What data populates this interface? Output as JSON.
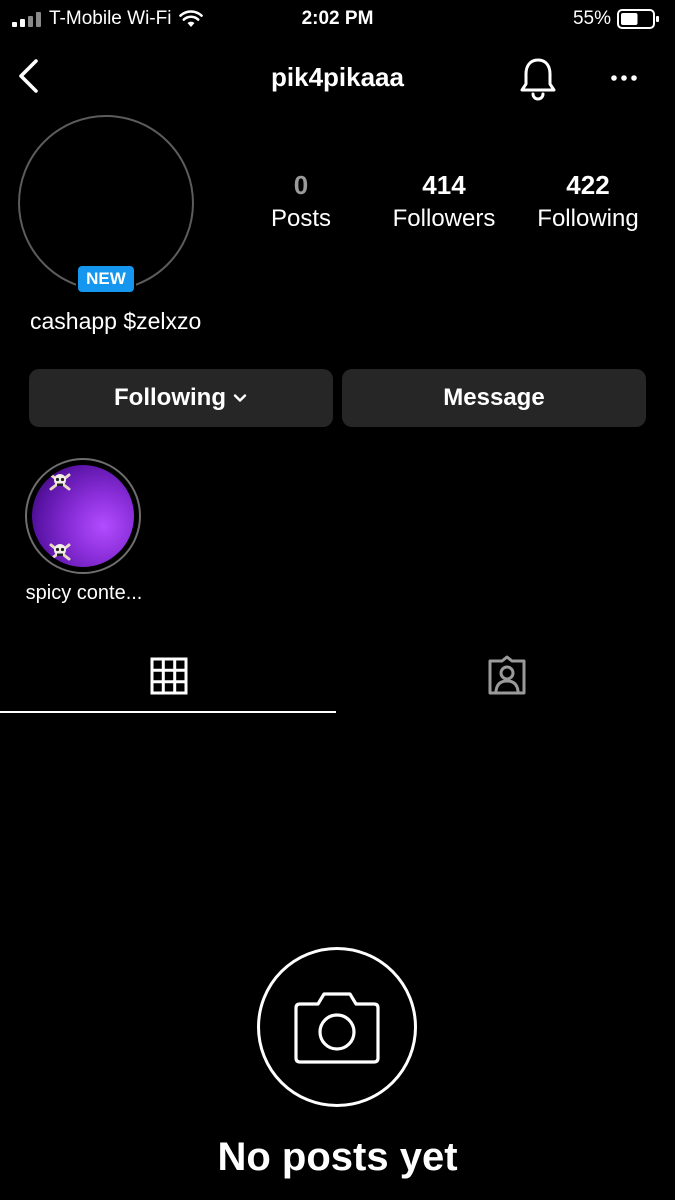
{
  "status_bar": {
    "carrier": "T-Mobile Wi-Fi",
    "time": "2:02 PM",
    "battery_percent": "55%",
    "battery_level": 0.55
  },
  "nav": {
    "title": "pik4pikaaa",
    "icons": [
      "chevron-left-icon",
      "bell-icon",
      "more-icon"
    ]
  },
  "profile": {
    "badge": "NEW",
    "bio": "cashapp $zelxzo",
    "stats": [
      {
        "count": "0",
        "label": "Posts"
      },
      {
        "count": "414",
        "label": "Followers"
      },
      {
        "count": "422",
        "label": "Following"
      }
    ]
  },
  "actions": {
    "following_label": "Following",
    "message_label": "Message"
  },
  "highlights": [
    {
      "label": "spicy conte..."
    }
  ],
  "tabs": [
    {
      "icon": "grid-icon",
      "selected": true
    },
    {
      "icon": "tagged-icon",
      "selected": false
    }
  ],
  "empty_state": {
    "icon": "camera-icon",
    "title": "No posts yet"
  },
  "colors": {
    "background": "#000000",
    "button": "#262626",
    "badge": "#1597ef"
  }
}
